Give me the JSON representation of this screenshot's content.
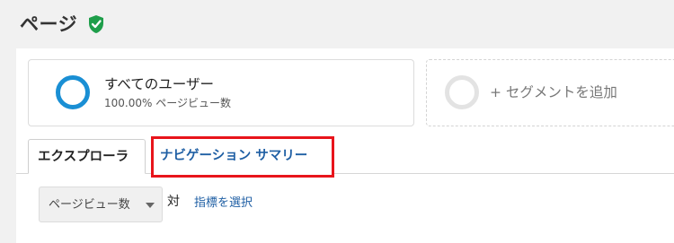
{
  "header": {
    "title": "ページ",
    "verified_icon": "shield-check-icon",
    "verified_color": "#1e9e4a"
  },
  "segments": {
    "all_users": {
      "name": "すべてのユーザー",
      "detail": "100.00% ページビュー数",
      "ring_color": "#1a8fd4"
    },
    "add_segment": {
      "label": "+ セグメントを追加",
      "ring_color": "#e3e3e3"
    }
  },
  "tabs": [
    {
      "label": "エクスプローラ",
      "active": true
    },
    {
      "label": "ナビゲーション サマリー",
      "active": false,
      "highlighted": true,
      "highlight_color": "#e8141b",
      "link_color": "#1f5fa4"
    }
  ],
  "metric_controls": {
    "primary_metric": "ページビュー数",
    "dropdown_icon": "caret-down-icon",
    "vs_label": "対",
    "select_metric_link": "指標を選択"
  }
}
